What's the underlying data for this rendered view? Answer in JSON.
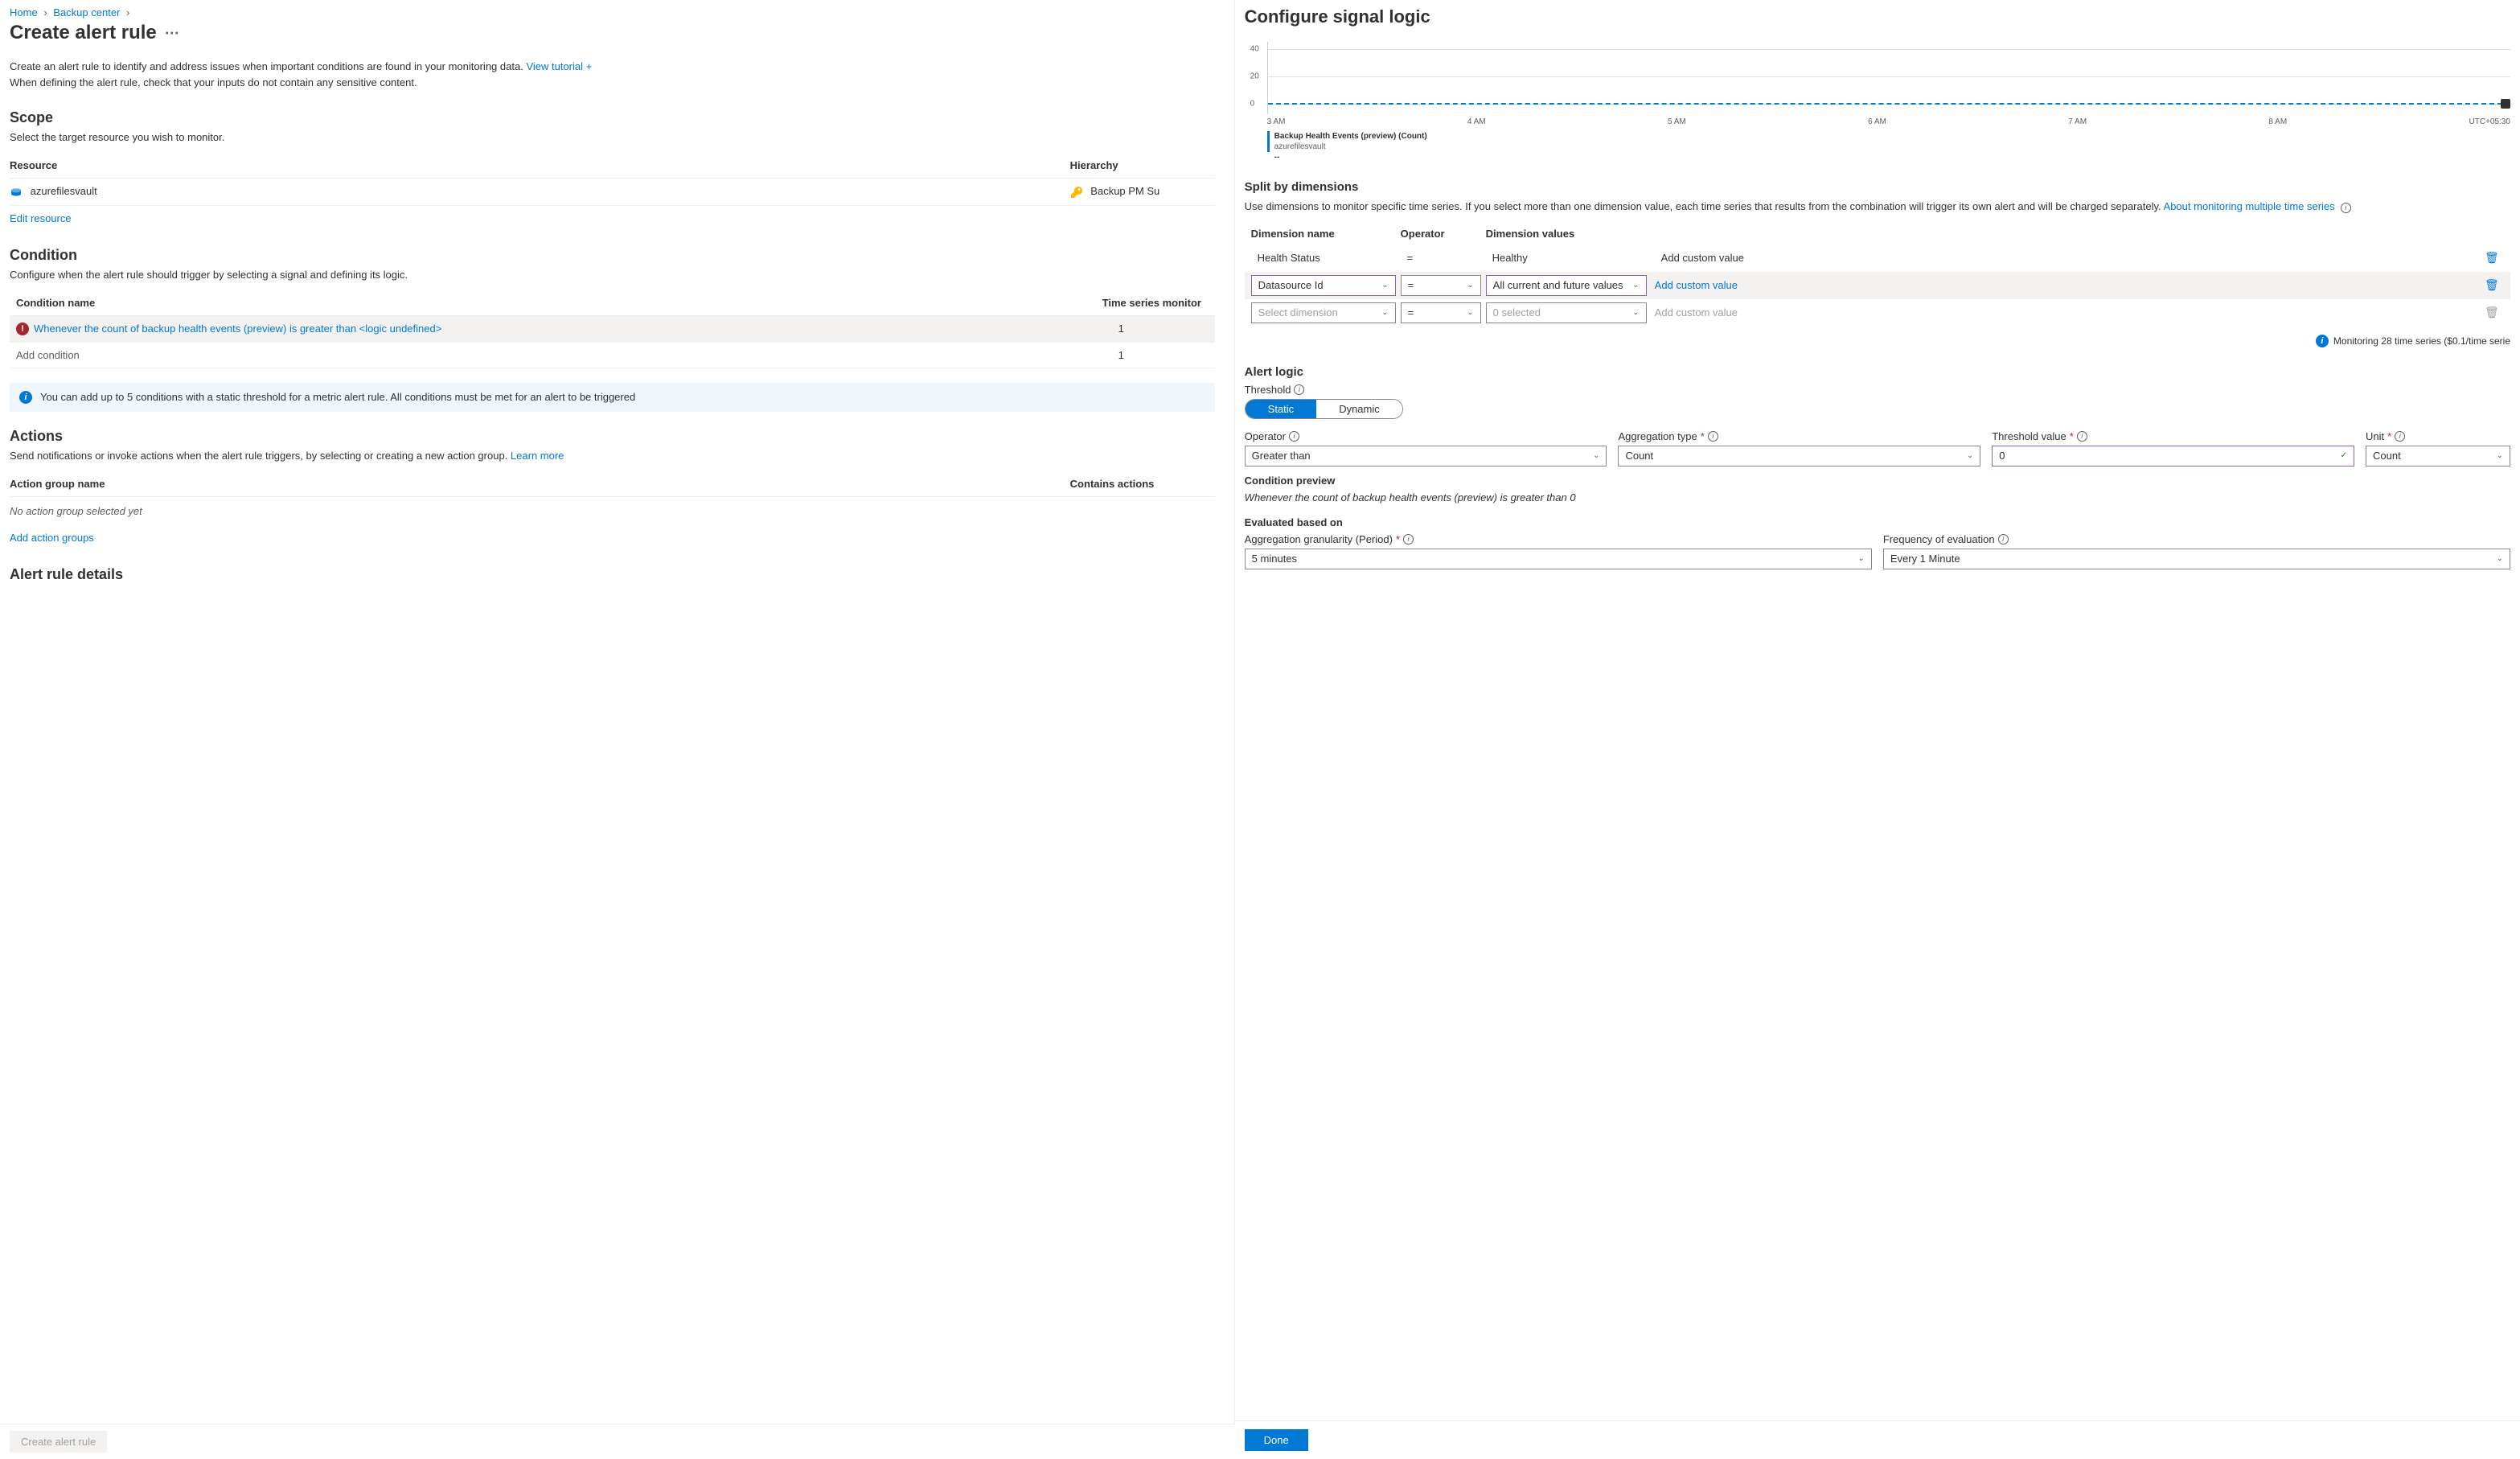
{
  "breadcrumb": {
    "home": "Home",
    "item": "Backup center"
  },
  "page": {
    "title": "Create alert rule",
    "intro1": "Create an alert rule to identify and address issues when important conditions are found in your monitoring data.",
    "tutorial": "View tutorial +",
    "intro2": "When defining the alert rule, check that your inputs do not contain any sensitive content."
  },
  "scope": {
    "heading": "Scope",
    "sub": "Select the target resource you wish to monitor.",
    "col_resource": "Resource",
    "col_hierarchy": "Hierarchy",
    "resource_name": "azurefilesvault",
    "hierarchy_name": "Backup PM Su",
    "edit": "Edit resource"
  },
  "condition": {
    "heading": "Condition",
    "sub": "Configure when the alert rule should trigger by selecting a signal and defining its logic.",
    "col_name": "Condition name",
    "col_ts": "Time series monitor",
    "row1_name": "Whenever the count of backup health events (preview) is greater than <logic undefined>",
    "row1_ts": "1",
    "add": "Add condition",
    "add_ts": "1",
    "info": "You can add up to 5 conditions with a static threshold for a metric alert rule. All conditions must be met for an alert to be triggered"
  },
  "actions": {
    "heading": "Actions",
    "sub": "Send notifications or invoke actions when the alert rule triggers, by selecting or creating a new action group.",
    "learn": "Learn more",
    "col_name": "Action group name",
    "col_contains": "Contains actions",
    "none": "No action group selected yet",
    "add": "Add action groups"
  },
  "details": {
    "heading": "Alert rule details"
  },
  "footer": {
    "create": "Create alert rule"
  },
  "signal": {
    "title": "Configure signal logic",
    "legend_name": "Backup Health Events (preview) (Count)",
    "legend_sub": "azurefilesvault",
    "legend_val": "--",
    "x_ticks": [
      "3 AM",
      "4 AM",
      "5 AM",
      "6 AM",
      "7 AM",
      "8 AM",
      "UTC+05:30"
    ]
  },
  "chart_data": {
    "type": "line",
    "title": "Backup Health Events (preview) (Count)",
    "ylabel": "",
    "xlabel": "",
    "ylim": [
      0,
      40
    ],
    "y_ticks": [
      0,
      20,
      40
    ],
    "categories": [
      "3 AM",
      "4 AM",
      "5 AM",
      "6 AM",
      "7 AM",
      "8 AM"
    ],
    "series": [
      {
        "name": "azurefilesvault",
        "values": [
          0,
          0,
          0,
          0,
          0,
          0
        ]
      }
    ]
  },
  "split": {
    "heading": "Split by dimensions",
    "desc": "Use dimensions to monitor specific time series. If you select more than one dimension value, each time series that results from the combination will trigger its own alert and will be charged separately.",
    "learn": "About monitoring multiple time series",
    "col_name": "Dimension name",
    "col_op": "Operator",
    "col_vals": "Dimension values",
    "row1_name": "Health Status",
    "row1_op": "=",
    "row1_vals": "Healthy",
    "row1_cust": "Add custom value",
    "row2_name": "Datasource Id",
    "row2_op": "=",
    "row2_vals": "All current and future values",
    "row2_cust": "Add custom value",
    "row3_name": "Select dimension",
    "row3_op": "=",
    "row3_vals": "0 selected",
    "row3_cust": "Add custom value",
    "monitoring": "Monitoring 28 time series ($0.1/time serie"
  },
  "logic": {
    "heading": "Alert logic",
    "threshold_label": "Threshold",
    "static": "Static",
    "dynamic": "Dynamic",
    "operator_label": "Operator",
    "operator_val": "Greater than",
    "agg_label": "Aggregation type",
    "agg_val": "Count",
    "thresh_label": "Threshold value",
    "thresh_val": "0",
    "unit_label": "Unit",
    "unit_val": "Count",
    "preview_label": "Condition preview",
    "preview_text": "Whenever the count of backup health events (preview) is greater than 0",
    "eval_heading": "Evaluated based on",
    "gran_label": "Aggregation granularity (Period)",
    "gran_val": "5 minutes",
    "freq_label": "Frequency of evaluation",
    "freq_val": "Every 1 Minute"
  },
  "done": "Done"
}
